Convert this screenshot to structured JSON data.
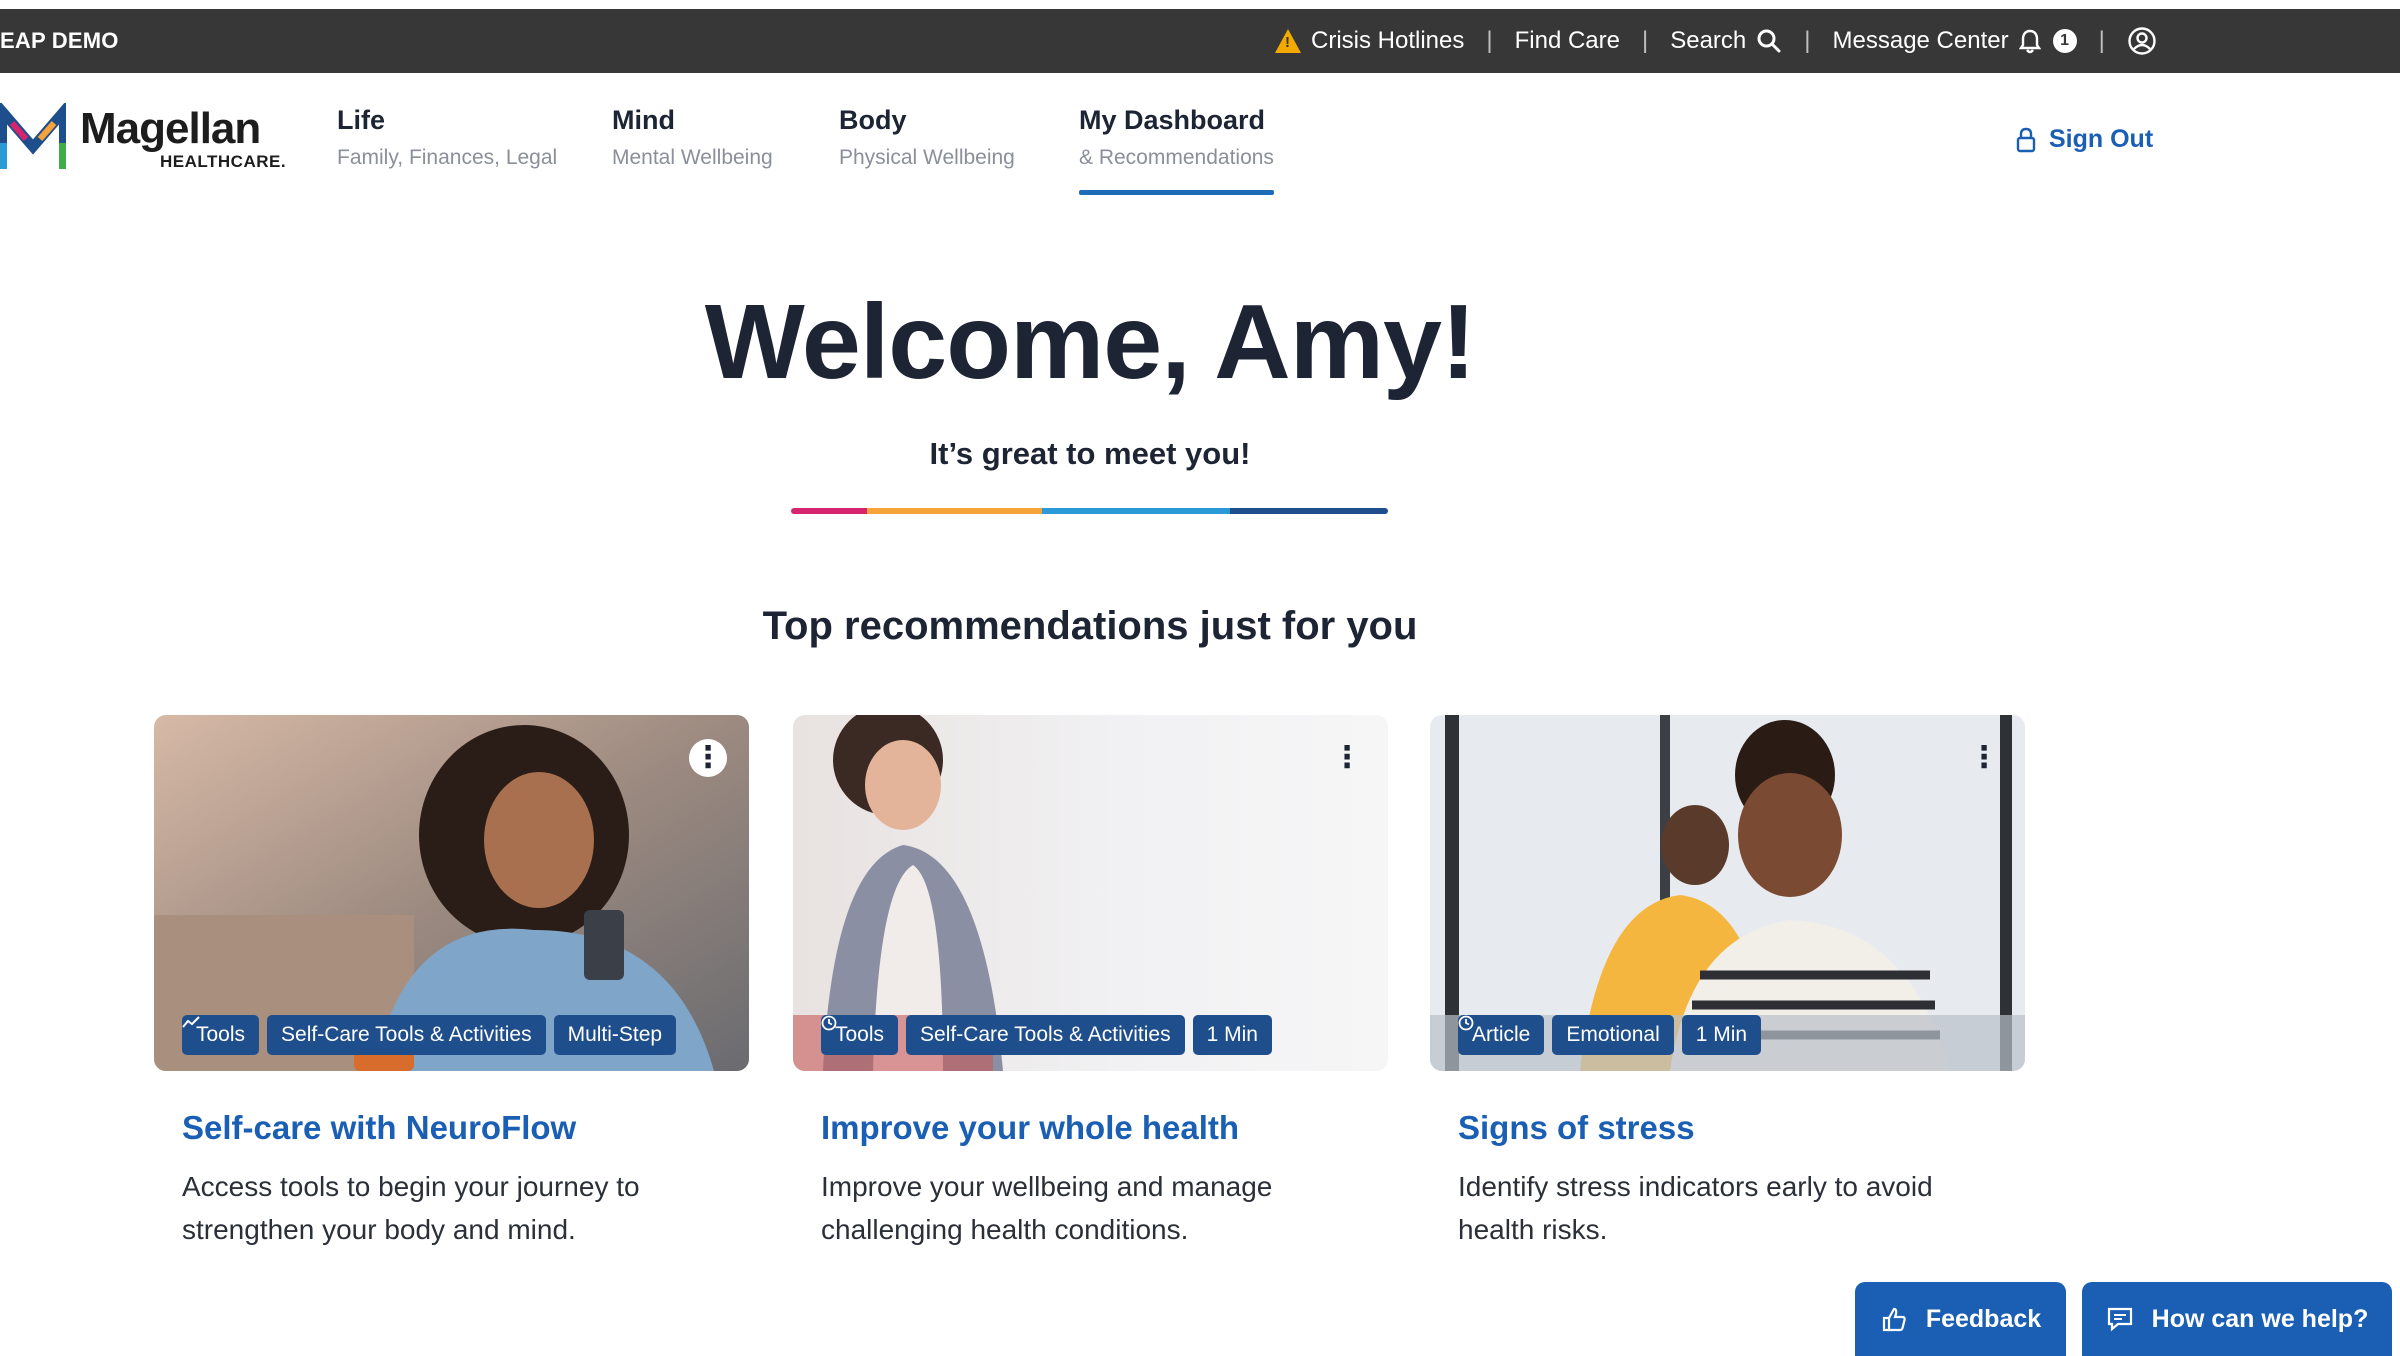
{
  "utility_bar": {
    "brand": "EAP DEMO",
    "crisis": "Crisis Hotlines",
    "find_care": "Find Care",
    "search": "Search",
    "message_center": "Message Center",
    "notification_count": "1"
  },
  "logo": {
    "name": "Magellan",
    "sub": "HEALTHCARE."
  },
  "nav": {
    "tabs": [
      {
        "title": "Life",
        "subtitle": "Family, Finances, Legal"
      },
      {
        "title": "Mind",
        "subtitle": "Mental Wellbeing"
      },
      {
        "title": "Body",
        "subtitle": "Physical Wellbeing"
      },
      {
        "title": "My Dashboard",
        "subtitle": "& Recommendations"
      }
    ],
    "active_tab": "My Dashboard",
    "sign_out": "Sign Out"
  },
  "hero": {
    "welcome": "Welcome, Amy!",
    "subtitle": "It’s great to meet you!",
    "rainbow_colors": [
      "#d6246e",
      "#f6a33a",
      "#2a9ad6",
      "#1f4e8c"
    ]
  },
  "recommendations": {
    "heading": "Top recommendations just for you",
    "cards": [
      {
        "title": "Self-care with NeuroFlow",
        "description": "Access tools to begin your journey to strengthen your body and mind.",
        "tags": [
          "Tools",
          "Self-Care Tools & Activities",
          "Multi-Step"
        ]
      },
      {
        "title": "Improve your whole health",
        "description": "Improve your wellbeing and manage challenging health conditions.",
        "tags": [
          "Tools",
          "Self-Care Tools & Activities",
          "1 Min"
        ]
      },
      {
        "title": "Signs of stress",
        "description": "Identify stress indicators early to avoid health risks.",
        "tags": [
          "Article",
          "Emotional",
          "1 Min"
        ]
      }
    ]
  },
  "floating": {
    "feedback": "Feedback",
    "help": "How can we help?"
  },
  "colors": {
    "utility_bg": "#373737",
    "accent_blue": "#1a5fb4",
    "tag_blue": "#1f4e8c",
    "warning": "#f2a900"
  }
}
